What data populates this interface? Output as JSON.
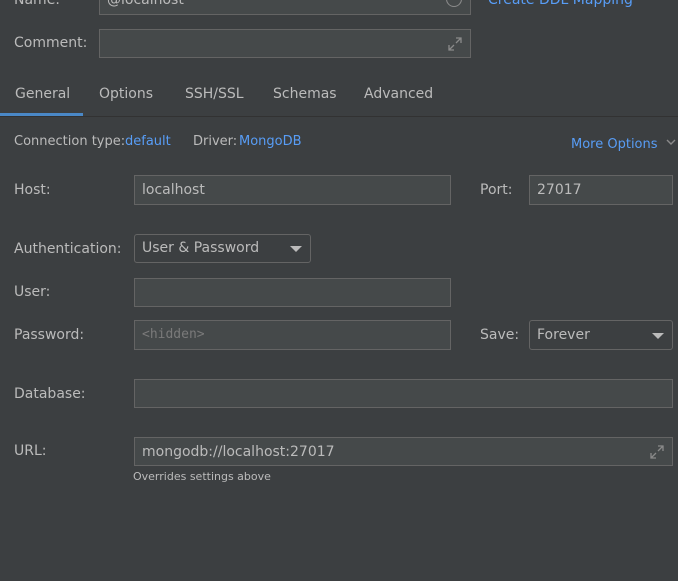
{
  "name": {
    "label": "Name:",
    "value": "@localhost",
    "link": "Create DDL Mapping"
  },
  "comment": {
    "label": "Comment:",
    "value": ""
  },
  "tabs": [
    {
      "label": "General",
      "active": true
    },
    {
      "label": "Options",
      "active": false
    },
    {
      "label": "SSH/SSL",
      "active": false
    },
    {
      "label": "Schemas",
      "active": false
    },
    {
      "label": "Advanced",
      "active": false
    }
  ],
  "connection": {
    "type_label": "Connection type:",
    "type_value": "default",
    "driver_label": "Driver:",
    "driver_value": "MongoDB",
    "more_options": "More Options"
  },
  "host": {
    "label": "Host:",
    "value": "localhost"
  },
  "port": {
    "label": "Port:",
    "value": "27017"
  },
  "authentication": {
    "label": "Authentication:",
    "value": "User & Password"
  },
  "user": {
    "label": "User:",
    "value": ""
  },
  "password": {
    "label": "Password:",
    "placeholder": "<hidden>"
  },
  "save": {
    "label": "Save:",
    "value": "Forever"
  },
  "database": {
    "label": "Database:",
    "value": ""
  },
  "url": {
    "label": "URL:",
    "value": "mongodb://localhost:27017",
    "hint": "Overrides settings above"
  },
  "colors": {
    "background": "#3c3f41",
    "field": "#45494a",
    "border": "#646464",
    "text": "#bbbbbb",
    "link": "#589df6",
    "tab_underline": "#4a88c7"
  }
}
